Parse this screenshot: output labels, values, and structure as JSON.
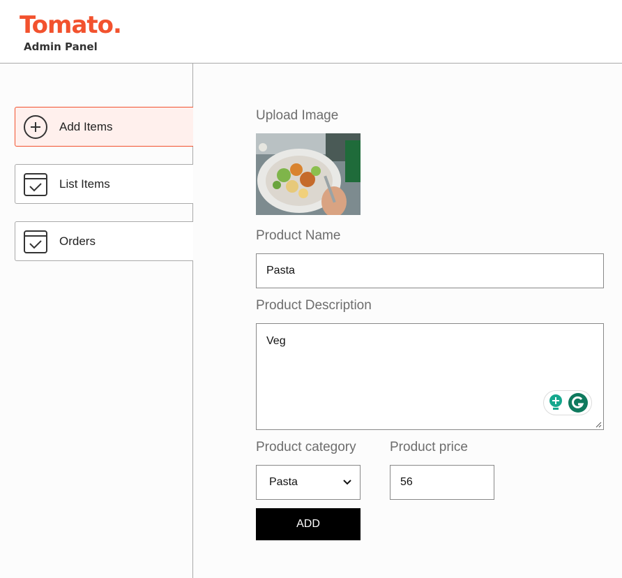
{
  "header": {
    "logo_text": "Tomato.",
    "subtitle": "Admin Panel",
    "accent_color": "#f2522e"
  },
  "sidebar": {
    "items": [
      {
        "label": "Add Items",
        "icon": "plus-circle-icon",
        "active": true
      },
      {
        "label": "List Items",
        "icon": "checklist-icon",
        "active": false
      },
      {
        "label": "Orders",
        "icon": "checklist-icon",
        "active": false
      }
    ]
  },
  "form": {
    "upload_label": "Upload Image",
    "upload_image_alt": "salad bowl photo",
    "name_label": "Product Name",
    "name_value": "Pasta",
    "description_label": "Product Description",
    "description_value": "Veg",
    "category_label": "Product category",
    "category_value": "Pasta",
    "price_label": "Product price",
    "price_value": "56",
    "submit_label": "ADD"
  }
}
